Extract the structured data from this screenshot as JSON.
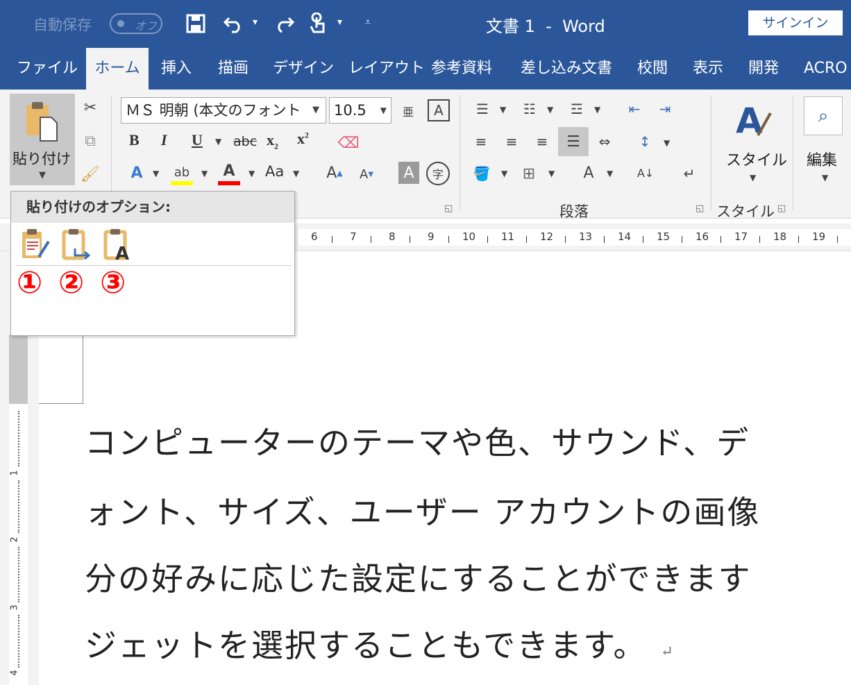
{
  "titlebar": {
    "autosave_label": "自動保存",
    "autosave_toggle": "オフ",
    "doc_title": "文書 1  -  Word",
    "signin": "サインイン"
  },
  "tabs": [
    {
      "label": "ファイル",
      "active": false
    },
    {
      "label": "ホーム",
      "active": true
    },
    {
      "label": "挿入",
      "active": false
    },
    {
      "label": "描画",
      "active": false
    },
    {
      "label": "デザイン",
      "active": false
    },
    {
      "label": "レイアウト",
      "active": false
    },
    {
      "label": "参考資料",
      "active": false
    },
    {
      "label": "差し込み文書",
      "active": false
    },
    {
      "label": "校閲",
      "active": false
    },
    {
      "label": "表示",
      "active": false
    },
    {
      "label": "開発",
      "active": false
    },
    {
      "label": "ACRO",
      "active": false
    }
  ],
  "ribbon": {
    "paste_label": "貼り付け",
    "font_name": "ＭＳ 明朝 (本文のフォント",
    "font_size": "10.5",
    "paragraph_group": "段落",
    "styles_group": "スタイル",
    "styles_button": "スタイル",
    "editing_button": "編集",
    "case_button": "Aa",
    "bold": "B",
    "italic": "I",
    "underline": "U",
    "strike": "abc"
  },
  "popup": {
    "title": "貼り付けのオプション:",
    "markers": [
      "①",
      "②",
      "③"
    ]
  },
  "ruler": {
    "numbers": [
      "6",
      "7",
      "8",
      "9",
      "10",
      "11",
      "12",
      "13",
      "14",
      "15",
      "16",
      "17",
      "18",
      "19"
    ],
    "vertical_numbers": [
      "1",
      "2",
      "3",
      "4"
    ]
  },
  "document": {
    "lines": [
      "コンピューターのテーマや色、サウンド、デ",
      "ォント、サイズ、ユーザー アカウントの画像",
      "分の好みに応じた設定にすることができます",
      "ジェットを選択することもできます。"
    ],
    "paragraph_mark": "↵"
  },
  "colors": {
    "brand": "#2b579a",
    "marker": "#ff0000",
    "highlight": "#ffff00",
    "font_color": "#ff0000"
  }
}
